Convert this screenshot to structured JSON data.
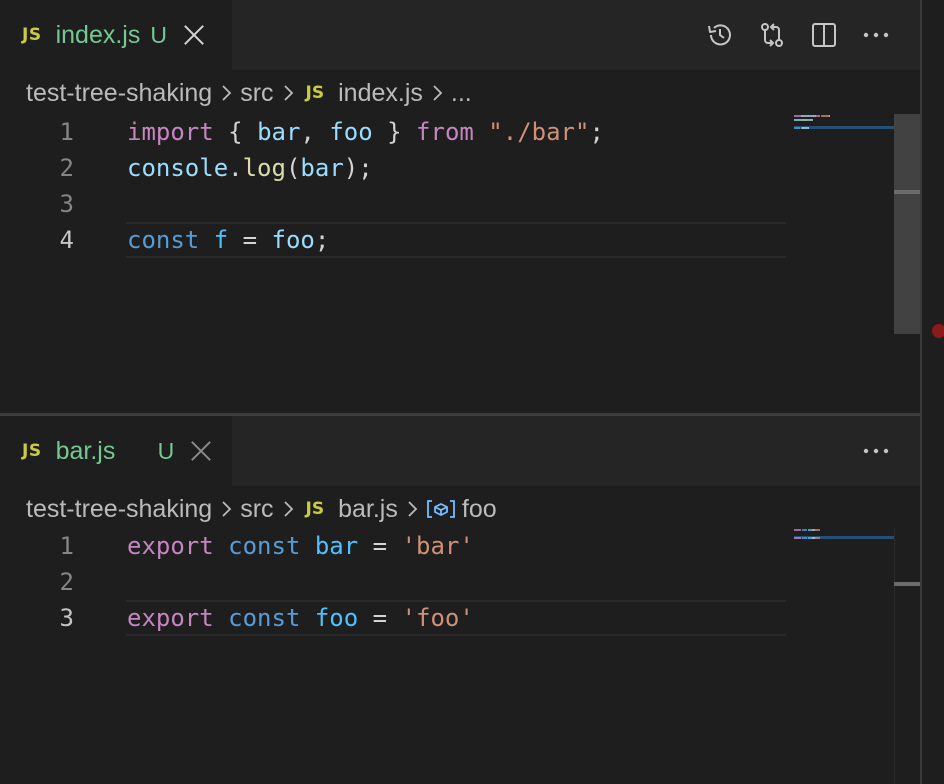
{
  "top_editor": {
    "tab": {
      "icon": "JS",
      "label": "index.js",
      "status": "U"
    },
    "actions": [
      "history-icon",
      "source-control-compare-icon",
      "split-editor-icon",
      "more-actions-icon"
    ],
    "breadcrumb": {
      "folder": "test-tree-shaking",
      "sub": "src",
      "file_icon": "JS",
      "file": "index.js",
      "more": "..."
    },
    "lines": [
      {
        "num": "1",
        "tokens": [
          [
            "import",
            "kw-purple"
          ],
          [
            " { ",
            "plain"
          ],
          [
            "bar",
            "var"
          ],
          [
            ", ",
            "plain"
          ],
          [
            "foo",
            "var"
          ],
          [
            " } ",
            "plain"
          ],
          [
            "from",
            "kw-purple"
          ],
          [
            " ",
            "plain"
          ],
          [
            "\"./bar\"",
            "str"
          ],
          [
            ";",
            "plain"
          ]
        ]
      },
      {
        "num": "2",
        "tokens": [
          [
            "console",
            "var"
          ],
          [
            ".",
            "plain"
          ],
          [
            "log",
            "fn"
          ],
          [
            "(",
            "plain"
          ],
          [
            "bar",
            "var"
          ],
          [
            ");",
            "plain"
          ]
        ]
      },
      {
        "num": "3",
        "tokens": []
      },
      {
        "num": "4",
        "tokens": [
          [
            "const",
            "kw-blue"
          ],
          [
            " ",
            "plain"
          ],
          [
            "f",
            "var2"
          ],
          [
            " = ",
            "plain"
          ],
          [
            "foo",
            "var"
          ],
          [
            ";",
            "plain"
          ]
        ]
      }
    ],
    "active_line": "4"
  },
  "bottom_editor": {
    "tab": {
      "icon": "JS",
      "label": "bar.js",
      "status": "U"
    },
    "actions": [
      "more-actions-icon"
    ],
    "breadcrumb": {
      "folder": "test-tree-shaking",
      "sub": "src",
      "file_icon": "JS",
      "file": "bar.js",
      "symbol_icon": "variable-icon",
      "symbol": "foo"
    },
    "lines": [
      {
        "num": "1",
        "tokens": [
          [
            "export",
            "kw-purple"
          ],
          [
            " ",
            "plain"
          ],
          [
            "const",
            "kw-blue"
          ],
          [
            " ",
            "plain"
          ],
          [
            "bar",
            "var2"
          ],
          [
            " = ",
            "plain"
          ],
          [
            "'bar'",
            "str"
          ]
        ]
      },
      {
        "num": "2",
        "tokens": []
      },
      {
        "num": "3",
        "tokens": [
          [
            "export",
            "kw-purple"
          ],
          [
            " ",
            "plain"
          ],
          [
            "const",
            "kw-blue"
          ],
          [
            " ",
            "plain"
          ],
          [
            "foo",
            "var2"
          ],
          [
            " = ",
            "plain"
          ],
          [
            "'foo'",
            "str"
          ]
        ]
      }
    ],
    "active_line": "3"
  },
  "colors": {
    "editor_bg": "#1e1e1e",
    "tab_bar_bg": "#252526",
    "untracked_green": "#73c991",
    "js_yellow": "#cbcb41",
    "error_dot": "#8b1a1a"
  }
}
